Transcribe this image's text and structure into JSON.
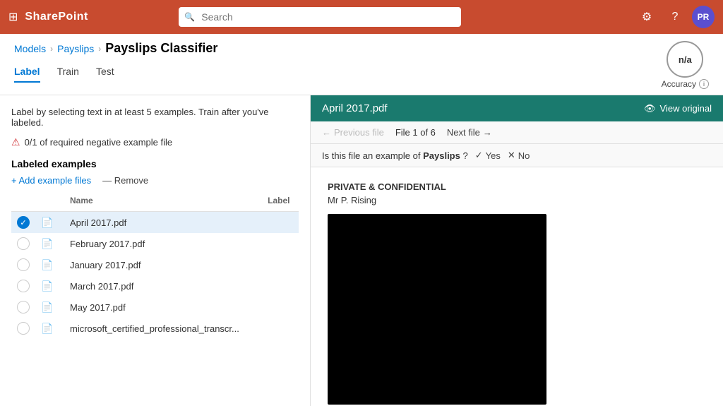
{
  "header": {
    "app_name": "SharePoint",
    "search_placeholder": "Search",
    "settings_icon": "⚙",
    "help_icon": "?",
    "avatar_initials": "PR"
  },
  "breadcrumb": {
    "models_label": "Models",
    "payslips_label": "Payslips",
    "current_label": "Payslips Classifier",
    "sep": "›"
  },
  "tabs": [
    {
      "id": "label",
      "label": "Label",
      "active": true
    },
    {
      "id": "train",
      "label": "Train",
      "active": false
    },
    {
      "id": "test",
      "label": "Test",
      "active": false
    }
  ],
  "accuracy": {
    "value": "n/a",
    "label": "Accuracy"
  },
  "left_panel": {
    "instruction": "Label by selecting text in at least 5 examples. Train after you've labeled.",
    "negative_example": "0/1 of required negative example file",
    "section_title": "Labeled examples",
    "add_button": "+ Add example files",
    "remove_button": "— Remove",
    "table_headers": {
      "name": "Name",
      "label": "Label"
    },
    "files": [
      {
        "id": 1,
        "name": "April 2017.pdf",
        "selected": true
      },
      {
        "id": 2,
        "name": "February 2017.pdf",
        "selected": false
      },
      {
        "id": 3,
        "name": "January 2017.pdf",
        "selected": false
      },
      {
        "id": 4,
        "name": "March 2017.pdf",
        "selected": false
      },
      {
        "id": 5,
        "name": "May 2017.pdf",
        "selected": false
      },
      {
        "id": 6,
        "name": "microsoft_certified_professional_transcr...",
        "selected": false
      }
    ]
  },
  "right_panel": {
    "file_title": "April 2017.pdf",
    "view_original": "View original",
    "nav": {
      "previous": "Previous file",
      "file_counter": "File 1 of 6",
      "next": "Next file"
    },
    "confirm": {
      "question": "Is this file an example of",
      "bold_word": "Payslips",
      "question_end": "?",
      "yes_label": "Yes",
      "no_label": "No"
    },
    "doc": {
      "header": "PRIVATE & CONFIDENTIAL",
      "sub": "Mr P. Rising"
    }
  }
}
